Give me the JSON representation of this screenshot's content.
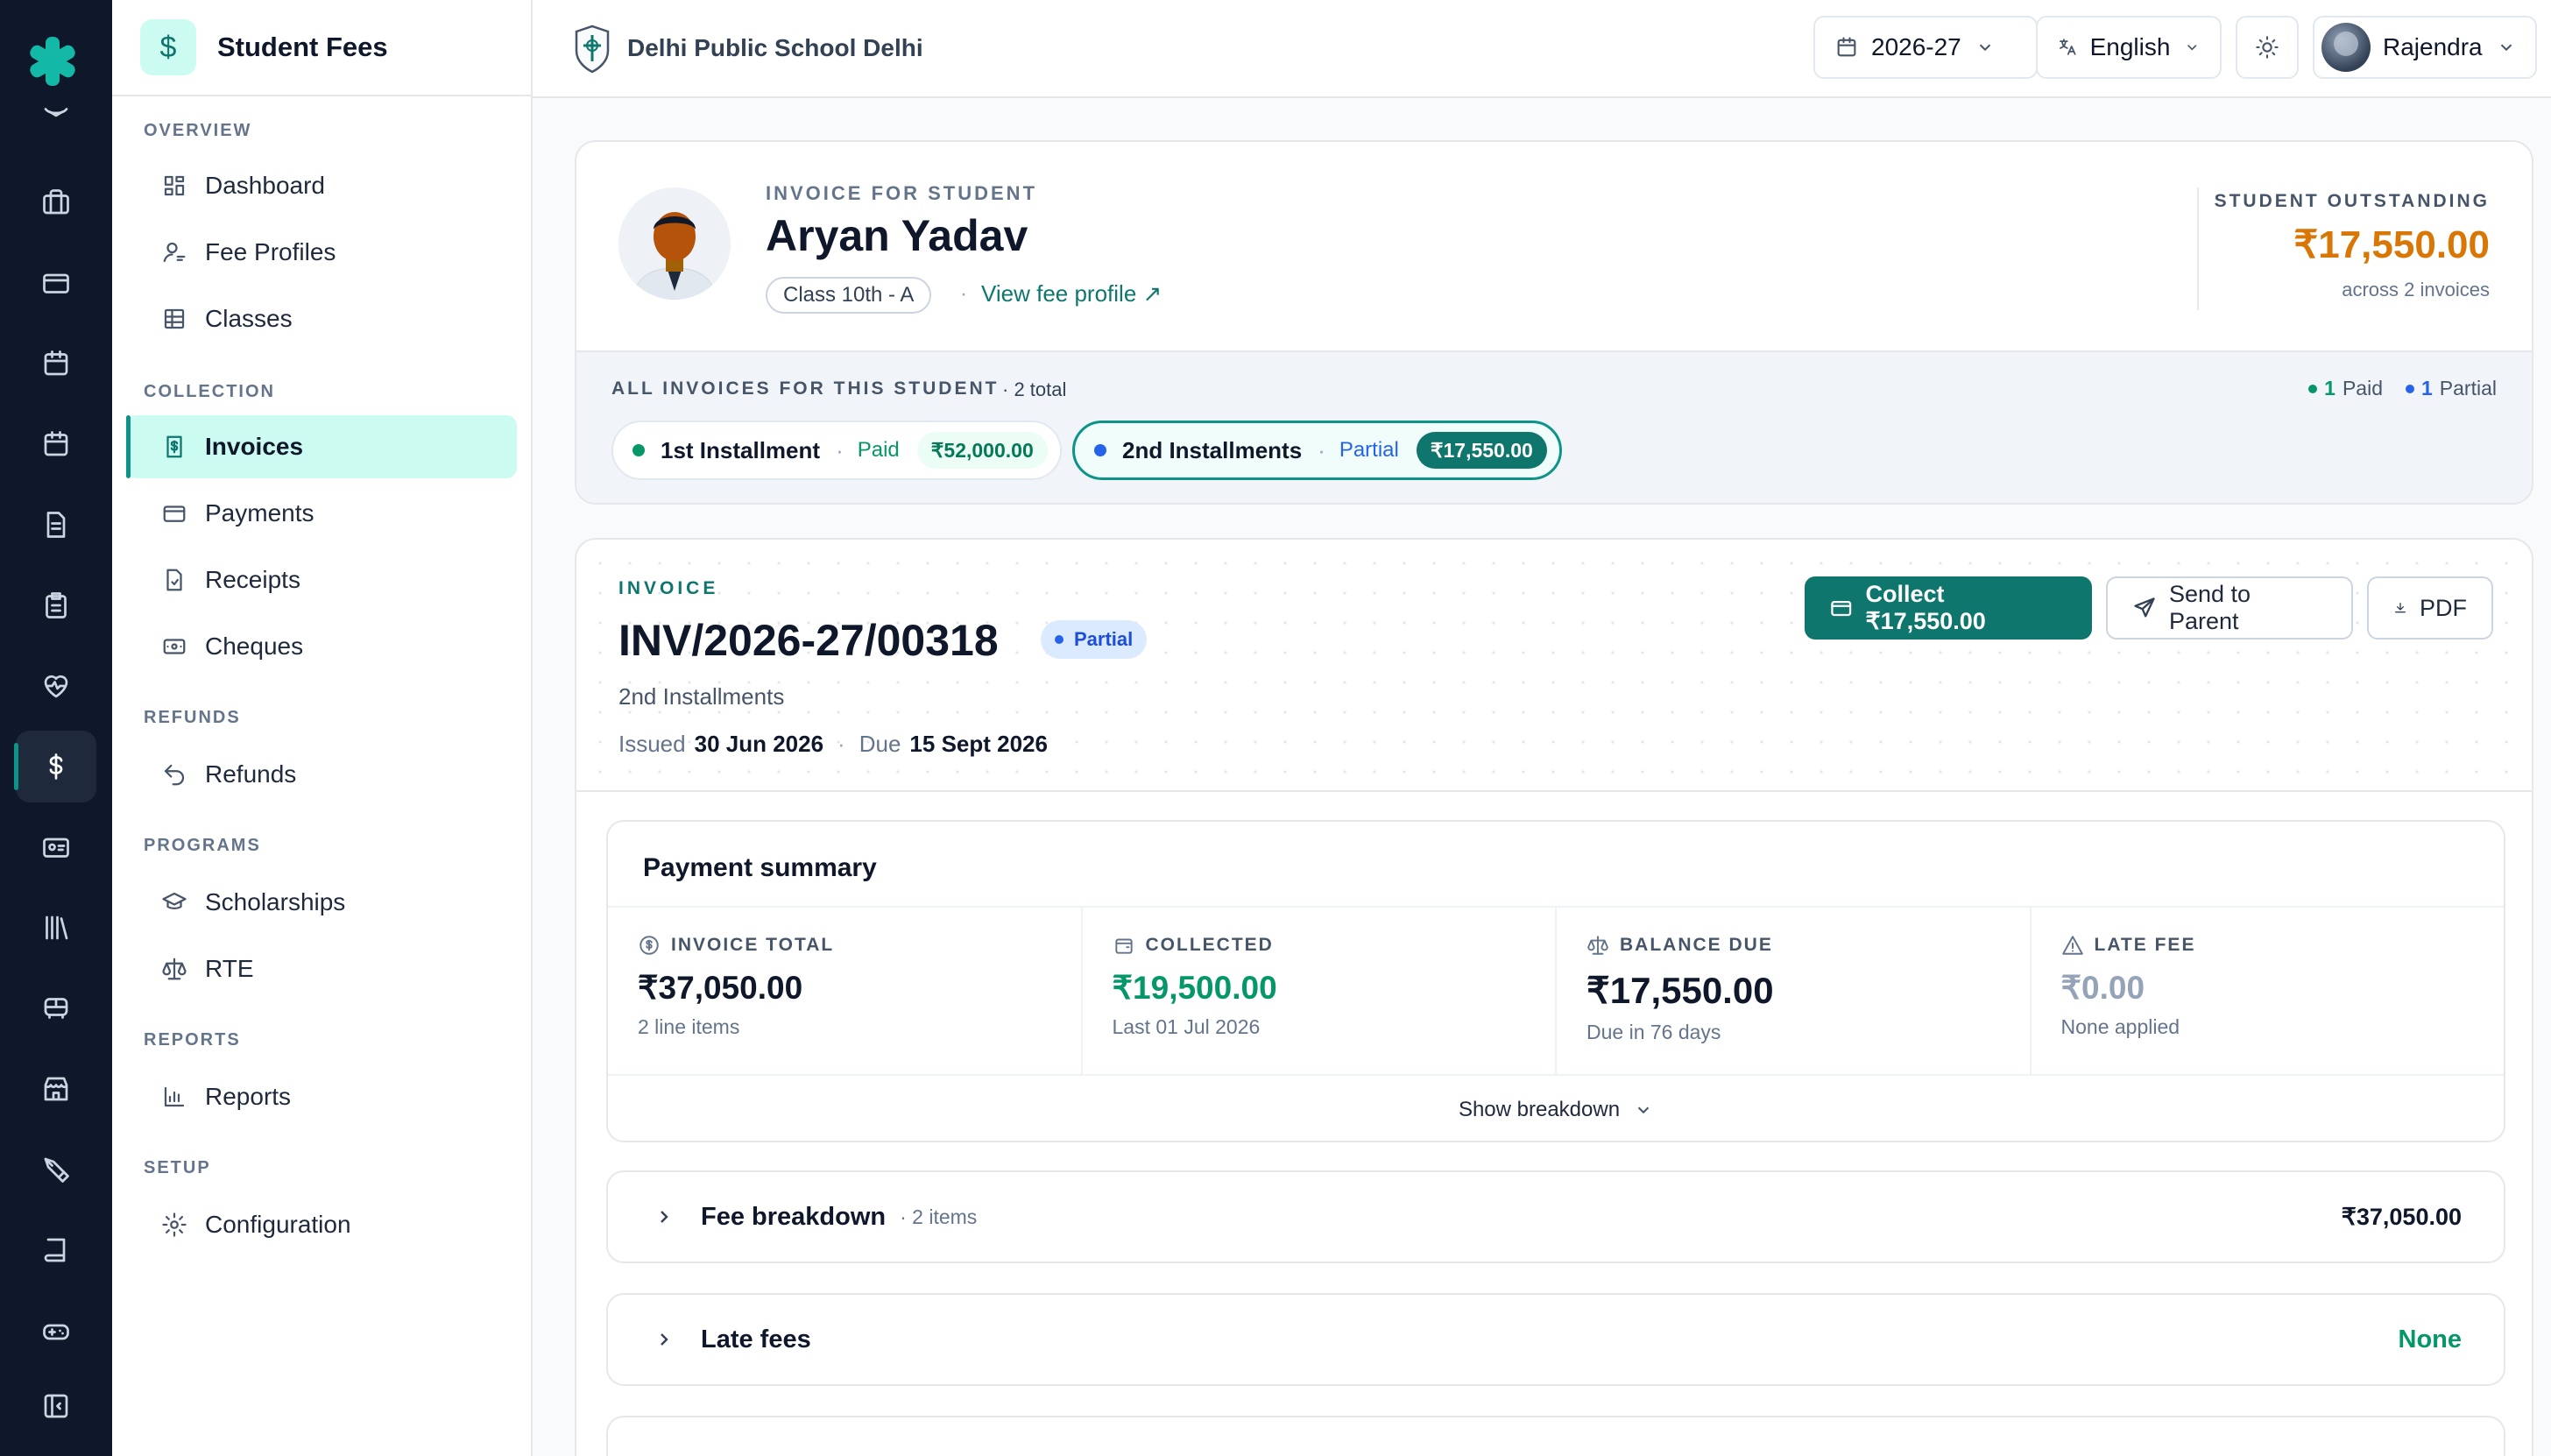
{
  "rail": {
    "icons": [
      "brand-asterisk-icon",
      "graduation-icon",
      "briefcase-icon",
      "credit-card-icon",
      "calendar-icon",
      "calendar-alt-icon",
      "document-icon",
      "clipboard-icon",
      "heart-pulse-icon",
      "dollar-icon",
      "id-card-icon",
      "library-icon",
      "bus-icon",
      "store-icon",
      "pen-tool-icon",
      "book-icon",
      "gamepad-icon",
      "collapse-panel-icon"
    ],
    "active": "dollar-icon"
  },
  "sidebar": {
    "title": "Student Fees",
    "sections": {
      "overview": "OVERVIEW",
      "collection": "COLLECTION",
      "refunds": "REFUNDS",
      "programs": "PROGRAMS",
      "reports": "REPORTS",
      "setup": "SETUP"
    },
    "items": {
      "dashboard": "Dashboard",
      "fee_profiles": "Fee Profiles",
      "classes": "Classes",
      "invoices": "Invoices",
      "payments": "Payments",
      "receipts": "Receipts",
      "cheques": "Cheques",
      "refunds": "Refunds",
      "scholarships": "Scholarships",
      "rte": "RTE",
      "reports": "Reports",
      "configuration": "Configuration"
    },
    "active_item": "Invoices"
  },
  "topbar": {
    "school_name": "Delhi Public School Delhi",
    "year": "2026-27",
    "language": "English",
    "user": "Rajendra"
  },
  "student": {
    "label": "INVOICE FOR STUDENT",
    "name": "Aryan Yadav",
    "class": "Class 10th - A",
    "profile_link": "View fee profile ↗",
    "outstanding_label": "STUDENT OUTSTANDING",
    "outstanding_amount": "₹17,550.00",
    "outstanding_note": "across 2 invoices",
    "all_invoices_label": "ALL INVOICES FOR THIS STUDENT",
    "all_invoices_total": "· 2 total",
    "legend": {
      "paid_count": "1",
      "paid_label": "Paid",
      "partial_count": "1",
      "partial_label": "Partial"
    },
    "invoices": [
      {
        "name": "1st Installment",
        "status": "Paid",
        "amount": "₹52,000.00"
      },
      {
        "name": "2nd Installments",
        "status": "Partial",
        "amount": "₹17,550.00"
      }
    ]
  },
  "invoice": {
    "label": "INVOICE",
    "number": "INV/2026-27/00318",
    "status": "Partial",
    "installment": "2nd Installments",
    "issued_label": "Issued",
    "issued_date": "30 Jun 2026",
    "due_label": "Due",
    "due_date": "15 Sept 2026",
    "actions": {
      "collect": "Collect ₹17,550.00",
      "send": "Send to Parent",
      "pdf": "PDF"
    }
  },
  "summary": {
    "title": "Payment summary",
    "cells": [
      {
        "label": "INVOICE TOTAL",
        "value": "₹37,050.00",
        "note": "2 line items"
      },
      {
        "label": "COLLECTED",
        "value": "₹19,500.00",
        "note": "Last 01 Jul 2026"
      },
      {
        "label": "BALANCE DUE",
        "value": "₹17,550.00",
        "note": "Due in 76 days"
      },
      {
        "label": "LATE FEE",
        "value": "₹0.00",
        "note": "None applied"
      }
    ],
    "toggle": "Show breakdown"
  },
  "sections": {
    "fee_breakdown": {
      "title": "Fee breakdown",
      "count": "· 2 items",
      "value": "₹37,050.00"
    },
    "late_fees": {
      "title": "Late fees",
      "value": "None"
    }
  },
  "colors": {
    "accent": "#0f766e",
    "rail_bg": "#0f172a",
    "outstanding": "#d97706",
    "paid": "#059669",
    "partial": "#2563eb"
  }
}
